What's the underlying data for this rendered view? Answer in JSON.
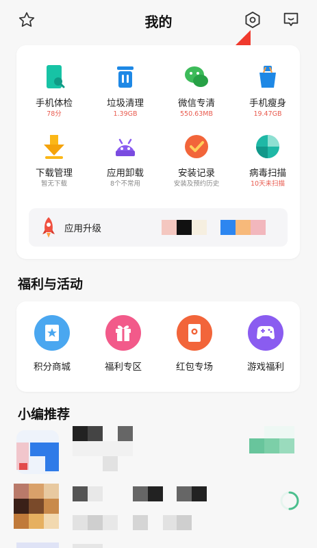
{
  "header": {
    "title": "我的"
  },
  "tools": [
    {
      "name": "手机体检",
      "sub": "78分",
      "sub_color": "red",
      "icon": "phone-checkup-icon"
    },
    {
      "name": "垃圾清理",
      "sub": "1.39GB",
      "sub_color": "red",
      "icon": "trash-clean-icon"
    },
    {
      "name": "微信专清",
      "sub": "550.63MB",
      "sub_color": "red",
      "icon": "wechat-clean-icon"
    },
    {
      "name": "手机瘦身",
      "sub": "19.47GB",
      "sub_color": "red",
      "icon": "phone-slim-icon"
    },
    {
      "name": "下载管理",
      "sub": "暂无下载",
      "sub_color": "gray",
      "icon": "download-icon"
    },
    {
      "name": "应用卸载",
      "sub": "8个不常用",
      "sub_color": "gray",
      "icon": "app-uninstall-icon"
    },
    {
      "name": "安装记录",
      "sub": "安装及预约历史",
      "sub_color": "gray",
      "icon": "install-record-icon"
    },
    {
      "name": "病毒扫描",
      "sub": "10天未扫描",
      "sub_color": "red",
      "icon": "virus-scan-icon"
    }
  ],
  "upgrade": {
    "label": "应用升级"
  },
  "sections": {
    "welfare": "福利与活动",
    "recommend": "小编推荐"
  },
  "welfare": [
    {
      "name": "积分商城",
      "icon": "points-mall-icon",
      "color": "#4aa7f0"
    },
    {
      "name": "福利专区",
      "icon": "gift-icon",
      "color": "#f25a8a"
    },
    {
      "name": "红包专场",
      "icon": "red-packet-icon",
      "color": "#f2653a"
    },
    {
      "name": "游戏福利",
      "icon": "gamepad-icon",
      "color": "#8a5cf0"
    }
  ],
  "colors": {
    "accent_red": "#e8594d",
    "arrow": "#f03a2e"
  }
}
